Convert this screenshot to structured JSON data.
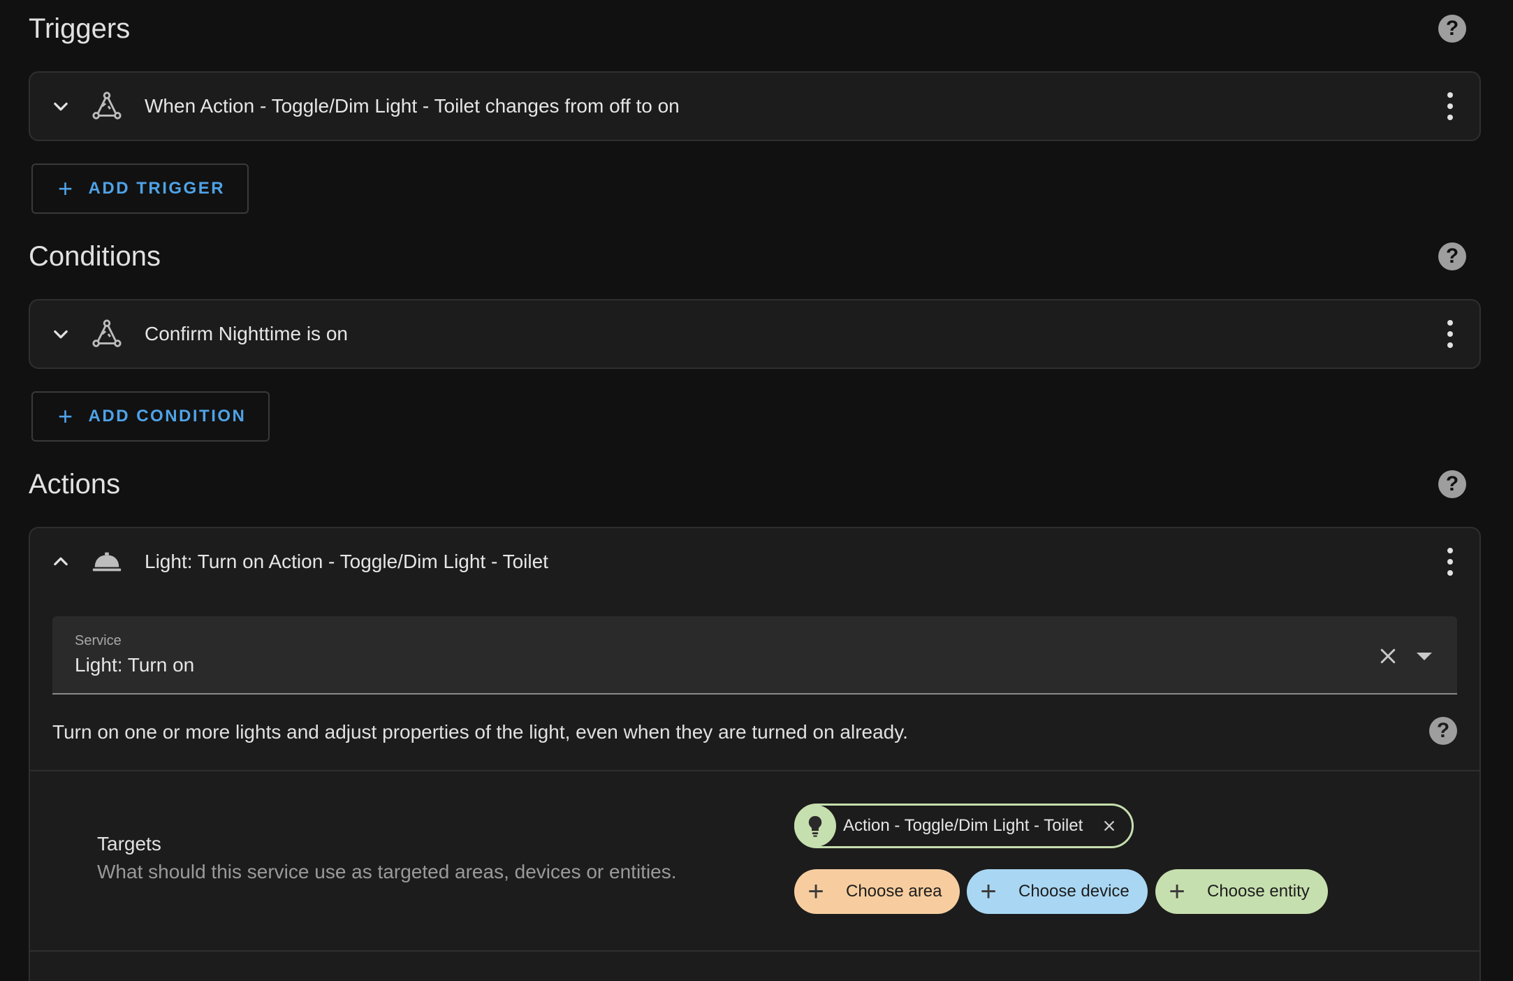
{
  "triggers": {
    "title": "Triggers",
    "items": [
      {
        "label": "When Action - Toggle/Dim Light - Toilet changes from off to on",
        "icon": "device-trigger-icon"
      }
    ],
    "add_label": "ADD TRIGGER"
  },
  "conditions": {
    "title": "Conditions",
    "items": [
      {
        "label": "Confirm Nighttime is on",
        "icon": "device-condition-icon"
      }
    ],
    "add_label": "ADD CONDITION"
  },
  "actions": {
    "title": "Actions",
    "items": [
      {
        "label": "Light: Turn on Action - Toggle/Dim Light - Toilet",
        "icon": "service-bell-icon",
        "service_field": {
          "label": "Service",
          "value": "Light: Turn on"
        },
        "description": "Turn on one or more lights and adjust properties of the light, even when they are turned on already.",
        "targets": {
          "label": "Targets",
          "description": "What should this service use as targeted areas, devices or entities.",
          "selected_entity": "Action - Toggle/Dim Light - Toilet",
          "choose_area": "Choose area",
          "choose_device": "Choose device",
          "choose_entity": "Choose entity"
        }
      }
    ]
  },
  "colors": {
    "background": "#111111",
    "card": "#1c1c1c",
    "accent_link": "#4fa3e8",
    "area_chip": "#f7cd9f",
    "device_chip": "#a9d7f3",
    "entity_chip": "#c6dfae"
  }
}
